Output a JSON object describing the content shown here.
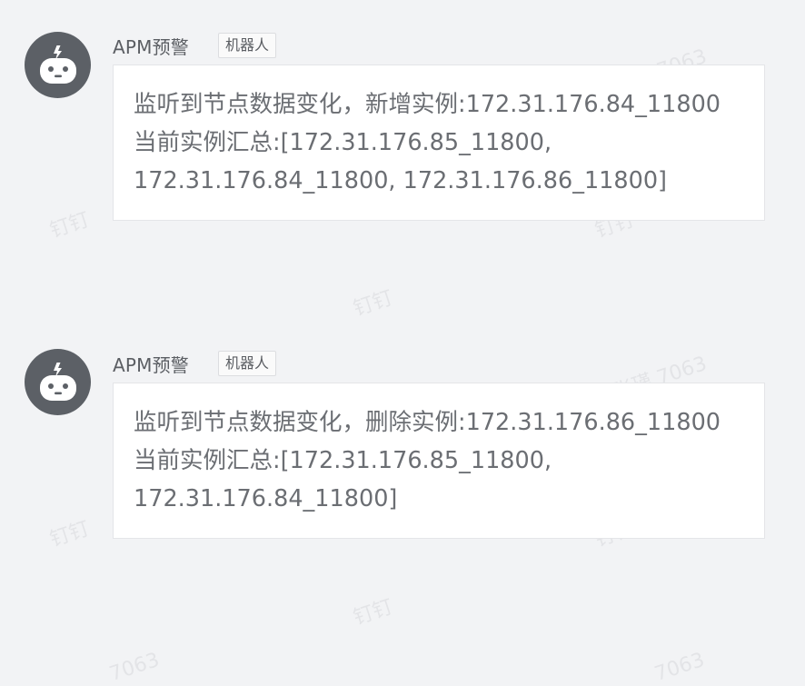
{
  "watermarks": [
    "钉钉",
    "钉钉",
    "钉钉",
    "钉钉",
    "钉钉",
    "钉钉",
    "张瑾 7063",
    "张瑾 7063",
    "7063",
    "7063"
  ],
  "messages": [
    {
      "sender": "APM预警",
      "tag": "机器人",
      "lines": [
        "监听到节点数据变化，新增实例:172.31.176.84_11800",
        "当前实例汇总:[172.31.176.85_11800,",
        "172.31.176.84_11800, 172.31.176.86_11800]"
      ]
    },
    {
      "sender": "APM预警",
      "tag": "机器人",
      "lines": [
        "监听到节点数据变化，删除实例:172.31.176.86_11800",
        "当前实例汇总:[172.31.176.85_11800,",
        "172.31.176.84_11800]"
      ]
    }
  ],
  "colors": {
    "background": "#f2f3f5",
    "avatar": "#5c6066",
    "bubble": "#ffffff",
    "text": "#6b6e73"
  },
  "icons": {
    "avatar": "robot-icon"
  }
}
